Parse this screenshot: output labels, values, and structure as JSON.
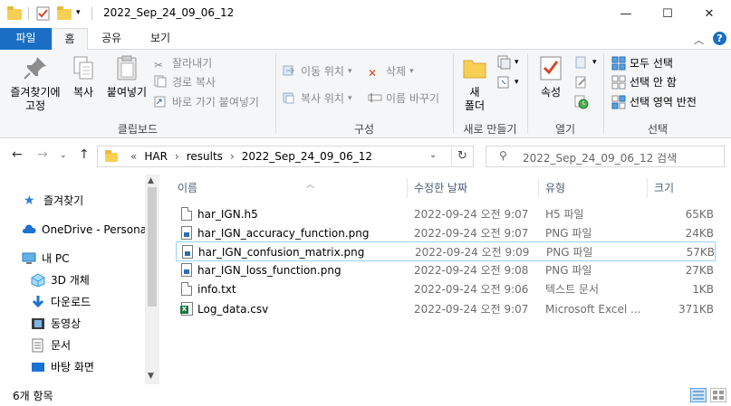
{
  "window": {
    "title": "2022_Sep_24_09_06_12",
    "minimize": "—",
    "maximize": "☐",
    "close": "✕"
  },
  "tabs": {
    "file": "파일",
    "home": "홈",
    "share": "공유",
    "view": "보기"
  },
  "ribbon": {
    "clipboard": {
      "label": "클립보드",
      "pin": "즐겨찾기에\n고정",
      "pin_line1": "즐겨찾기에",
      "pin_line2": "고정",
      "copy": "복사",
      "paste": "붙여넣기",
      "cut": "잘라내기",
      "copy_path": "경로 복사",
      "paste_shortcut": "바로 가기 붙여넣기"
    },
    "organize": {
      "label": "구성",
      "move_to": "이동 위치",
      "copy_to": "복사 위치",
      "delete": "삭제",
      "rename": "이름 바꾸기"
    },
    "new": {
      "label": "새로 만들기",
      "new_folder_line1": "새",
      "new_folder_line2": "폴더"
    },
    "open": {
      "label": "열기",
      "properties": "속성"
    },
    "select": {
      "label": "선택",
      "select_all": "모두 선택",
      "select_none": "선택 안 함",
      "invert": "선택 영역 반전"
    }
  },
  "address": {
    "overflow": "«",
    "crumbs": [
      "HAR",
      "results",
      "2022_Sep_24_09_06_12"
    ],
    "separator": "›"
  },
  "search": {
    "placeholder": "2022_Sep_24_09_06_12 검색"
  },
  "nav_pane": {
    "items": [
      {
        "label": "즐겨찾기",
        "icon": "star-icon"
      },
      {
        "label": "OneDrive - Personal",
        "icon": "cloud-icon"
      },
      {
        "label": "내 PC",
        "icon": "computer-icon"
      },
      {
        "label": "3D 개체",
        "icon": "cube-icon"
      },
      {
        "label": "다운로드",
        "icon": "download-icon"
      },
      {
        "label": "동영상",
        "icon": "video-icon"
      },
      {
        "label": "문서",
        "icon": "document-icon"
      },
      {
        "label": "바탕 화면",
        "icon": "desktop-icon"
      }
    ]
  },
  "columns": {
    "name": "이름",
    "date": "수정한 날짜",
    "type": "유형",
    "size": "크기"
  },
  "files": [
    {
      "name": "har_IGN.h5",
      "date": "2022-09-24 오전 9:07",
      "type": "H5 파일",
      "size": "65KB",
      "icon": "file-icon"
    },
    {
      "name": "har_IGN_accuracy_function.png",
      "date": "2022-09-24 오전 9:07",
      "type": "PNG 파일",
      "size": "24KB",
      "icon": "image-file-icon"
    },
    {
      "name": "har_IGN_confusion_matrix.png",
      "date": "2022-09-24 오전 9:09",
      "type": "PNG 파일",
      "size": "57KB",
      "icon": "image-file-icon"
    },
    {
      "name": "har_IGN_loss_function.png",
      "date": "2022-09-24 오전 9:08",
      "type": "PNG 파일",
      "size": "27KB",
      "icon": "image-file-icon"
    },
    {
      "name": "info.txt",
      "date": "2022-09-24 오전 9:06",
      "type": "텍스트 문서",
      "size": "1KB",
      "icon": "text-file-icon"
    },
    {
      "name": "Log_data.csv",
      "date": "2022-09-24 오전 9:07",
      "type": "Microsoft Excel ...",
      "size": "371KB",
      "icon": "excel-file-icon"
    }
  ],
  "status": {
    "item_count": "6개 항목"
  }
}
